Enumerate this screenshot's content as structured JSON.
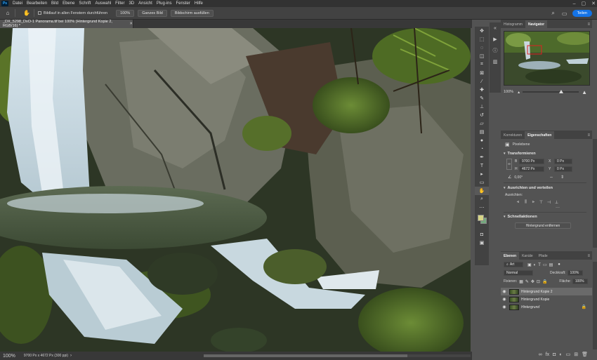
{
  "menubar": {
    "logo": "Ps",
    "items": [
      "Datei",
      "Bearbeiten",
      "Bild",
      "Ebene",
      "Schrift",
      "Auswahl",
      "Filter",
      "3D",
      "Ansicht",
      "Plug-ins",
      "Fenster",
      "Hilfe"
    ]
  },
  "optionsbar": {
    "scroll_all_label": "Bildlauf in allen Fenstern durchführen",
    "zoom_100": "100%",
    "fit_screen": "Ganzes Bild",
    "fill_screen": "Bildschirm ausfüllen",
    "share": "Teilen"
  },
  "document": {
    "tab_title": "_DX_5298_DxO-1 Panorama.tif bei 100% (Hintergrund Kopie 2, RGB/16) *"
  },
  "status": {
    "zoom": "100%",
    "info": "9700 Px x 4672 Px (300 ppi)"
  },
  "navigator_panel": {
    "tabs": [
      "Histogramm",
      "Navigator"
    ],
    "active_tab": "Navigator",
    "zoom": "100%"
  },
  "properties_panel": {
    "tabs": [
      "Korrekturen",
      "Eigenschaften"
    ],
    "active_tab": "Eigenschaften",
    "type_label": "Pixelebene",
    "transform": {
      "title": "Transformieren",
      "w_label": "B",
      "w_value": "9700 Px",
      "h_label": "H",
      "h_value": "4672 Px",
      "x_label": "X",
      "x_value": "0 Px",
      "y_label": "Y",
      "y_value": "0 Px",
      "angle": "0,00°"
    },
    "align": {
      "title": "Ausrichten und verteilen",
      "sub": "Ausrichten:"
    },
    "quick_actions": {
      "title": "Schnellaktionen",
      "button": "Hintergrund entfernen"
    }
  },
  "layers_panel": {
    "tabs": [
      "Ebenen",
      "Kanäle",
      "Pfade"
    ],
    "active_tab": "Ebenen",
    "filter_kind": "Art",
    "blend_mode": "Normal",
    "opacity_label": "Deckkraft:",
    "opacity": "100%",
    "lock_label": "Fixieren:",
    "fill_label": "Fläche:",
    "fill": "100%",
    "layers": [
      {
        "name": "Hintergrund Kopie 2",
        "selected": true,
        "locked": false
      },
      {
        "name": "Hintergrund Kopie",
        "selected": false,
        "locked": false
      },
      {
        "name": "Hintergrund",
        "selected": false,
        "locked": true
      }
    ]
  },
  "colors": {
    "foreground": "#d7d586",
    "background": "#75a87e",
    "accent": "#1473e6"
  }
}
